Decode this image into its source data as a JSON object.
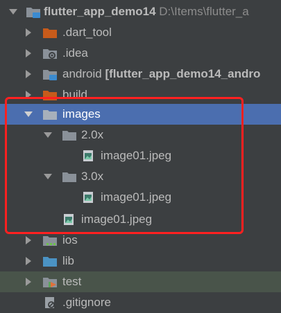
{
  "tree": {
    "root": {
      "name": "flutter_app_demo14",
      "path": "D:\\Items\\flutter_a"
    },
    "dart_tool": {
      "name": ".dart_tool"
    },
    "idea": {
      "name": ".idea"
    },
    "android": {
      "name": "android",
      "module_tag": "[flutter_app_demo14_andro"
    },
    "build": {
      "name": "build"
    },
    "images": {
      "name": "images"
    },
    "images_2x": {
      "name": "2.0x"
    },
    "images_2x_file": {
      "name": "image01.jpeg"
    },
    "images_3x": {
      "name": "3.0x"
    },
    "images_3x_file": {
      "name": "image01.jpeg"
    },
    "images_file": {
      "name": "image01.jpeg"
    },
    "ios": {
      "name": "ios"
    },
    "lib": {
      "name": "lib"
    },
    "test": {
      "name": "test"
    },
    "gitignore": {
      "name": ".gitignore"
    }
  },
  "colors": {
    "background": "#3c3f41",
    "selection": "#4b6eaf",
    "annotation_box": "#ff2020",
    "folder": "#8a9199",
    "excluded_folder": "#c75b1b",
    "source_folder": "#4b93c4"
  }
}
